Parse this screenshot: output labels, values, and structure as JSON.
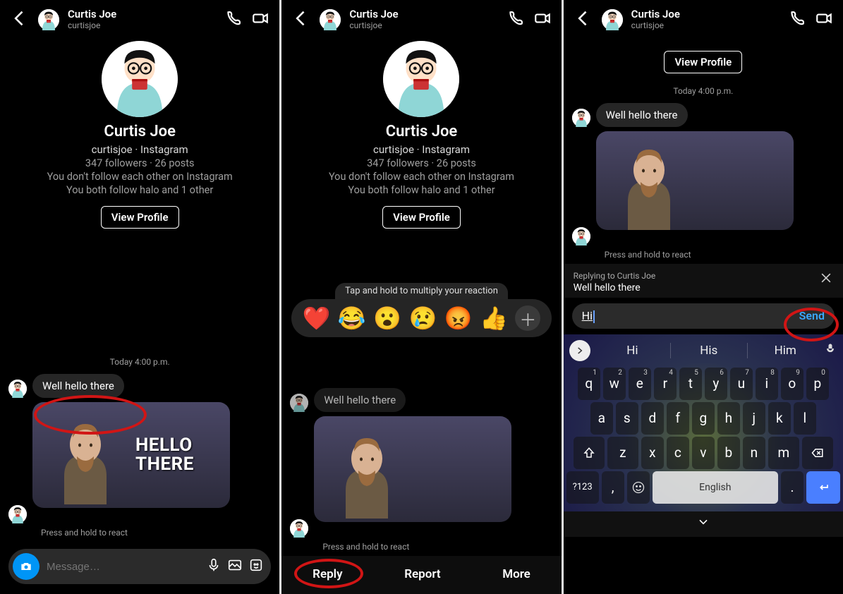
{
  "contact": {
    "name": "Curtis Joe",
    "username": "curtisjoe",
    "platform_line": "curtisjoe · Instagram",
    "stats_line": "347 followers · 26 posts",
    "follow_line_1": "You don't follow each other on Instagram",
    "follow_line_2": "You both follow halo and 1 other",
    "view_profile": "View Profile"
  },
  "timestamp": "Today 4:00 p.m.",
  "message": "Well hello there",
  "gif_text_1": "HELLO",
  "gif_text_2": "THERE",
  "react_hint": "Press and hold to react",
  "composer_placeholder": "Message…",
  "reaction_tip": "Tap and hold to multiply your reaction",
  "reactions": [
    "❤️",
    "😂",
    "😮",
    "😢",
    "😡",
    "👍"
  ],
  "actions": {
    "reply": "Reply",
    "report": "Report",
    "more": "More"
  },
  "reply": {
    "label": "Replying to Curtis Joe",
    "original": "Well hello there",
    "typed": "Hi",
    "send": "Send"
  },
  "keyboard": {
    "suggestions": [
      "Hi",
      "His",
      "Him"
    ],
    "row1_digits": [
      "1",
      "2",
      "3",
      "4",
      "5",
      "6",
      "7",
      "8",
      "9",
      "0"
    ],
    "row1": [
      "q",
      "w",
      "e",
      "r",
      "t",
      "y",
      "u",
      "i",
      "o",
      "p"
    ],
    "row2": [
      "a",
      "s",
      "d",
      "f",
      "g",
      "h",
      "j",
      "k",
      "l"
    ],
    "row3": [
      "z",
      "x",
      "c",
      "v",
      "b",
      "n",
      "m"
    ],
    "sym": "?123",
    "lang": "English",
    "comma": ",",
    "period": "."
  }
}
